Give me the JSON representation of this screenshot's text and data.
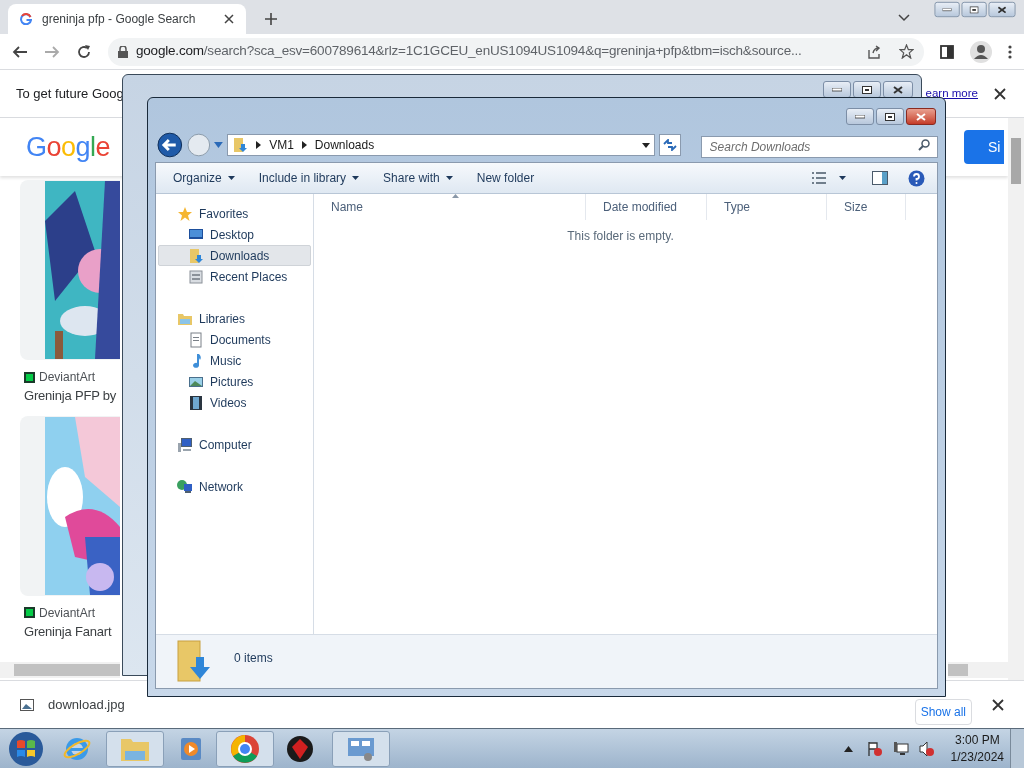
{
  "browser": {
    "tabs": [
      {
        "title": "greninja pfp - Google Search",
        "selected": true
      }
    ],
    "url_host": "google.com",
    "url_path": "/search?sca_esv=600789614&rlz=1C1GCEU_enUS1094US1094&q=greninja+pfp&tbm=isch&source...",
    "infobar": {
      "text": "To get future Goog",
      "link": "earn more"
    },
    "logo": "Google",
    "signin": "Si",
    "results": [
      {
        "source": "DeviantArt",
        "title": "Greninja PFP by"
      },
      {
        "source": "DeviantArt",
        "title": "Greninja Fanart"
      }
    ],
    "download": {
      "file": "download.jpg",
      "show_all": "Show all"
    }
  },
  "explorer": {
    "path": [
      "VM1",
      "Downloads"
    ],
    "search": {
      "placeholder": "Search Downloads"
    },
    "toolbar": [
      {
        "label": "Organize",
        "dropdown": true
      },
      {
        "label": "Include in library",
        "dropdown": true
      },
      {
        "label": "Share with",
        "dropdown": true
      },
      {
        "label": "New folder",
        "dropdown": false
      }
    ],
    "nav": [
      {
        "label": "Favorites",
        "selected": false,
        "children": [
          {
            "label": "Desktop",
            "selected": false
          },
          {
            "label": "Downloads",
            "selected": true
          },
          {
            "label": "Recent Places",
            "selected": false
          }
        ]
      },
      {
        "label": "Libraries",
        "selected": false,
        "children": [
          {
            "label": "Documents",
            "selected": false
          },
          {
            "label": "Music",
            "selected": false
          },
          {
            "label": "Pictures",
            "selected": false
          },
          {
            "label": "Videos",
            "selected": false
          }
        ]
      },
      {
        "label": "Computer",
        "selected": false
      },
      {
        "label": "Network",
        "selected": false
      }
    ],
    "columns": [
      "Name",
      "Date modified",
      "Type",
      "Size"
    ],
    "empty_text": "This folder is empty.",
    "status": "0 items"
  },
  "taskbar": {
    "clock": {
      "time": "3:00 PM",
      "date": "1/23/2024"
    }
  }
}
